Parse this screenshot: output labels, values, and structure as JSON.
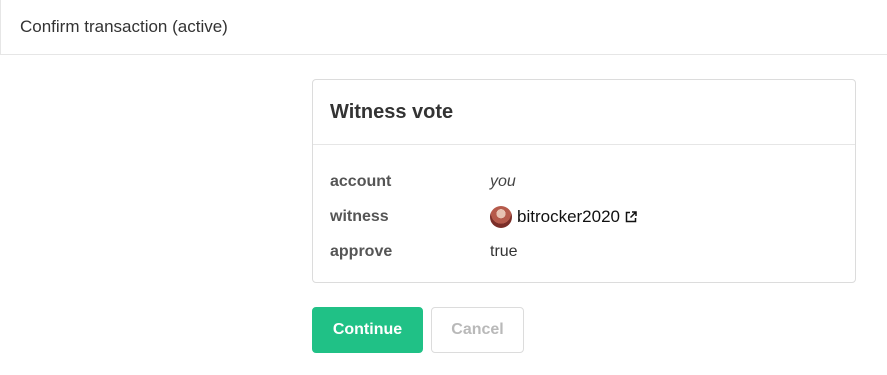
{
  "header": {
    "title": "Confirm transaction (active)"
  },
  "operation": {
    "title": "Witness vote",
    "fields": [
      {
        "key": "account",
        "value": "you"
      },
      {
        "key": "witness",
        "value": "bitrocker2020"
      },
      {
        "key": "approve",
        "value": "true"
      }
    ]
  },
  "actions": {
    "continue_label": "Continue",
    "cancel_label": "Cancel"
  },
  "colors": {
    "accent": "#20c186",
    "border": "#dcdcdc"
  },
  "icons": {
    "external_link": "external-link-icon",
    "avatar": "witness-avatar"
  }
}
